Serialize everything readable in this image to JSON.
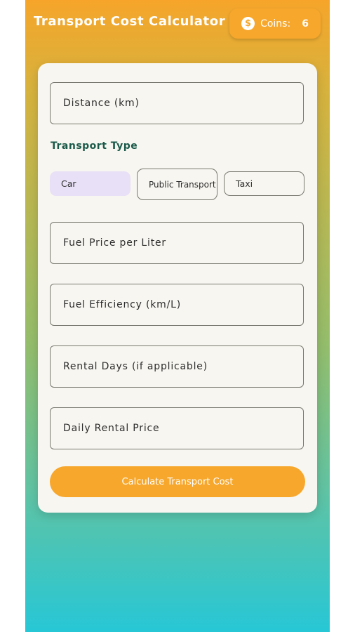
{
  "header": {
    "title": "Transport Cost Calculator",
    "coins_label": "Coins:",
    "coins_value": "6",
    "coin_icon": "dollar-coin-icon"
  },
  "form": {
    "distance_placeholder": "Distance (km)",
    "transport_type_label": "Transport Type",
    "transport_types": [
      "Car",
      "Public Transport",
      "Taxi"
    ],
    "selected_type": "Car",
    "fuel_price_placeholder": "Fuel Price per Liter",
    "fuel_efficiency_placeholder": "Fuel Efficiency (km/L)",
    "rental_days_placeholder": "Rental Days (if applicable)",
    "daily_rental_placeholder": "Daily Rental Price",
    "calculate_label": "Calculate Transport Cost"
  },
  "colors": {
    "accent": "#f7a72b",
    "selected_type_bg": "#e8e0f6",
    "section_label": "#1a5a4a"
  }
}
